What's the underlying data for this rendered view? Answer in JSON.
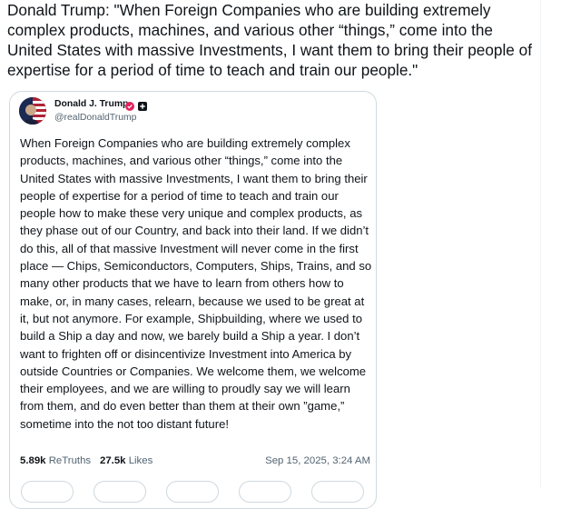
{
  "tweet": {
    "text": "Donald Trump: \"When Foreign Companies who are building extremely complex products, machines, and various other “things,” come into the United States with massive Investments, I want them to bring their people of expertise for a period of time to teach and train our people.\""
  },
  "embed": {
    "author_name": "Donald J. Trump",
    "author_handle": "@realDonaldTrump",
    "body": "When Foreign Companies who are building extremely complex products, machines, and various other “things,” come into the United States with massive Investments, I want them to bring their people of expertise for a period of time to teach and train our people how to make these very unique and complex products, as they phase out of our Country, and back into their land. If we didn’t do this, all of that massive Investment will never come in the first place — Chips, Semiconductors, Computers, Ships, Trains, and so many other products that we have to learn from others how to make, or, in many cases, relearn, because we used to be great at it, but not anymore. For example, Shipbuilding, where we used to build a Ship a day and now, we barely build a Ship a year. I don’t want to frighten off or disincentivize Investment into America by outside Countries or Companies. We welcome them, we welcome their employees, and we are willing to proudly say we will learn from them, and do even better than them at their own ”game,” sometime into the not too distant future!",
    "retruths_count": "5.89k",
    "retruths_label": "ReTruths",
    "likes_count": "27.5k",
    "likes_label": "Likes",
    "timestamp": "Sep 15, 2025, 3:24 AM",
    "icons": {
      "verified": "verified-badge-icon",
      "affiliate": "affiliate-badge-icon",
      "verified_color": "#e0245e"
    }
  },
  "colors": {
    "text": "#0f1419",
    "muted": "#536471",
    "border": "#cfd9de"
  }
}
